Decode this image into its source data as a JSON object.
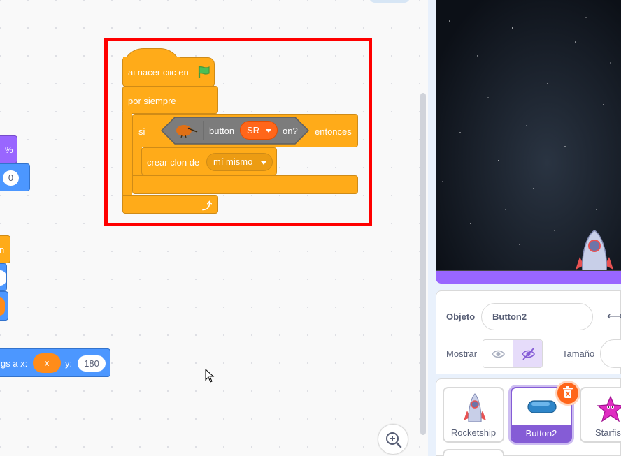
{
  "palette": {
    "percent_label": "%",
    "number_value": "0",
    "orange_partial_label": "n",
    "glide_label": "gs a x:",
    "glide_x_value": "x",
    "glide_y_label": "y:",
    "glide_y_value": "180"
  },
  "script": {
    "hat_label": "al hacer clic en",
    "forever_label": "por siempre",
    "if_label": "si",
    "then_label": "entonces",
    "sensor_button_label": "button",
    "sensor_dropdown_value": "SR",
    "sensor_on_label": "on?",
    "clone_label": "crear clon de",
    "clone_dropdown_value": "mí mismo"
  },
  "sprite_info": {
    "sprite_label": "Objeto",
    "sprite_name": "Button2",
    "show_label": "Mostrar",
    "size_label": "Tamaño"
  },
  "sprites": [
    {
      "name": "Rocketship",
      "selected": false
    },
    {
      "name": "Button2",
      "selected": true
    },
    {
      "name": "Starfis",
      "selected": false
    }
  ],
  "colors": {
    "events": "#ffab19",
    "motion": "#4c97ff",
    "operators_purple": "#9966ff",
    "sensor_extension": "#7c7c7c",
    "selected": "#855cd6",
    "highlight": "#ff0000"
  }
}
